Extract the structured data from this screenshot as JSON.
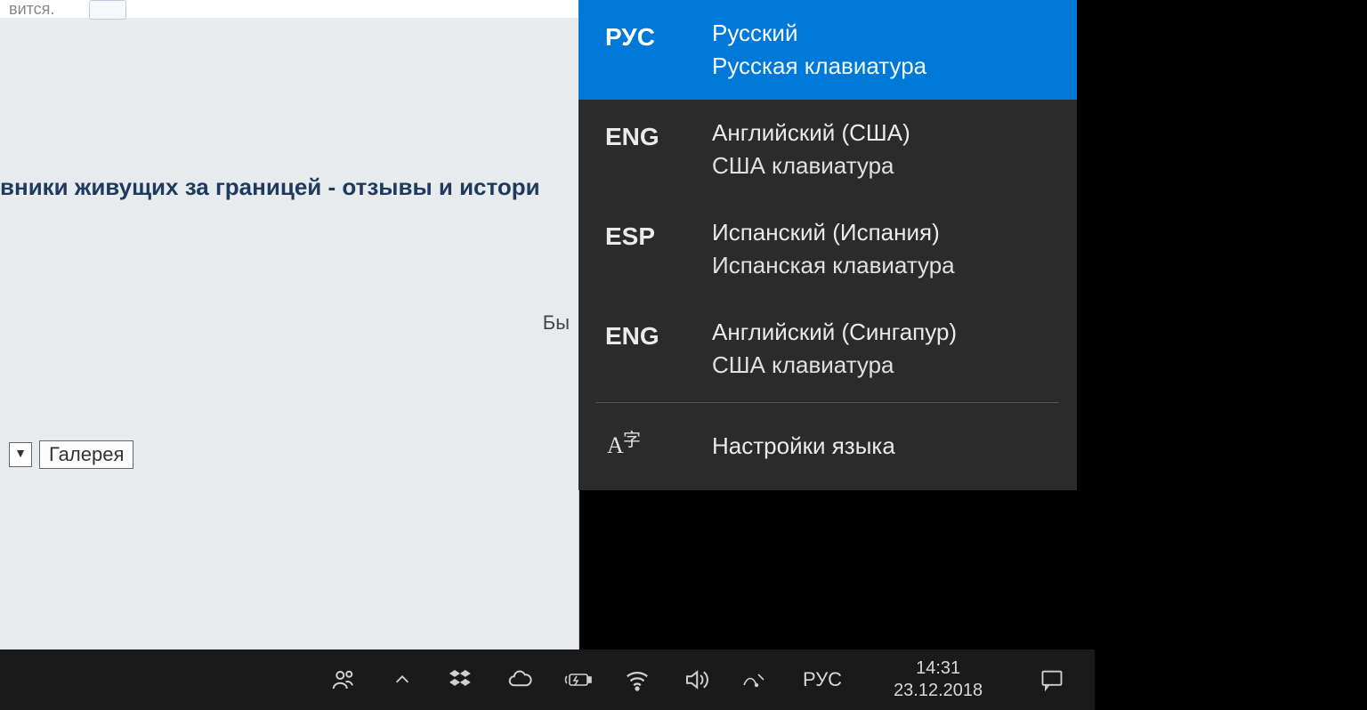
{
  "webpage": {
    "top_fragment": "вится.",
    "headline": "вники живущих за границей - отзывы и истори",
    "small_label": "Бы",
    "dropdown_arrow": "▼",
    "gallery_label": "Галерея"
  },
  "lang_popup": {
    "items": [
      {
        "code": "РУС",
        "name": "Русский",
        "keyboard": "Русская клавиатура",
        "selected": true
      },
      {
        "code": "ENG",
        "name": "Английский (США)",
        "keyboard": "США клавиатура",
        "selected": false
      },
      {
        "code": "ESP",
        "name": "Испанский (Испания)",
        "keyboard": "Испанская клавиатура",
        "selected": false
      },
      {
        "code": "ENG",
        "name": "Английский (Сингапур)",
        "keyboard": "США клавиатура",
        "selected": false
      }
    ],
    "settings_label": "Настройки языка"
  },
  "taskbar": {
    "lang_indicator": "РУС",
    "time": "14:31",
    "date": "23.12.2018"
  }
}
